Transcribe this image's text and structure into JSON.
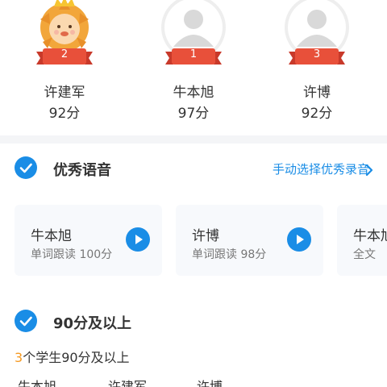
{
  "podium": [
    {
      "rank": "2",
      "name": "许建军",
      "score": "92分",
      "avatar": "lion-avatar"
    },
    {
      "rank": "1",
      "name": "牛本旭",
      "score": "97分",
      "avatar": "default-avatar"
    },
    {
      "rank": "3",
      "name": "许博",
      "score": "92分",
      "avatar": "default-avatar"
    }
  ],
  "excellent_voice": {
    "title": "优秀语音",
    "link_label": "手动选择优秀录音",
    "cards": [
      {
        "name": "牛本旭",
        "detail": "单词跟读 100分"
      },
      {
        "name": "许博",
        "detail": "单词跟读 98分"
      },
      {
        "name": "牛本旭",
        "detail": "全文"
      }
    ]
  },
  "high_score": {
    "title": "90分及以上",
    "count": "3",
    "count_suffix": "个学生90分及以上",
    "students": [
      "牛本旭",
      "许建军",
      "许博"
    ]
  },
  "colors": {
    "accent": "#1a8de6",
    "ribbon": "#e8503a",
    "highlight": "#f59a23"
  }
}
